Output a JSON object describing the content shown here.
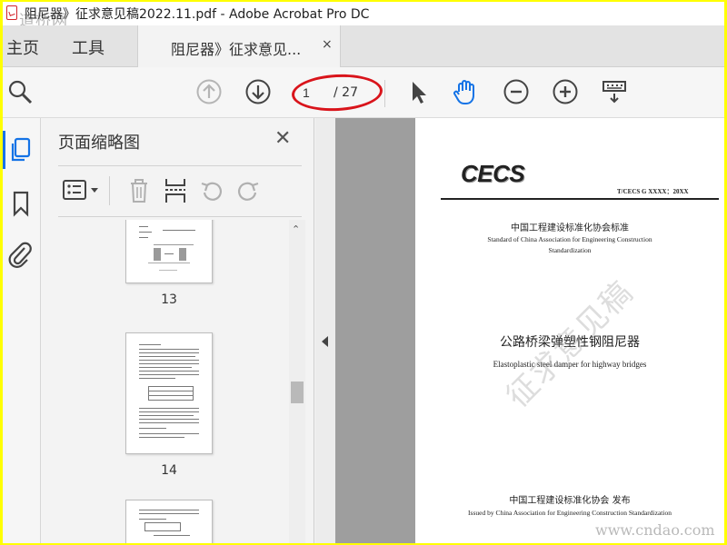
{
  "window": {
    "title": "阻尼器》征求意见稿2022.11.pdf - Adobe Acrobat Pro DC",
    "watermark_top": "道桥网"
  },
  "tabs": {
    "home": "主页",
    "tools": "工具",
    "document": "阻尼器》征求意见...",
    "close": "×"
  },
  "toolbar": {
    "current_page": "1",
    "total_pages": "/ 27",
    "icons": [
      "zoom-search-icon",
      "page-up-icon",
      "page-down-icon",
      "select-cursor-icon",
      "hand-icon",
      "zoom-out-icon",
      "zoom-in-icon",
      "keyboard-input-icon"
    ],
    "highlight_color": "#d9141b"
  },
  "sidebar": {
    "icons": [
      "page-thumbnails-icon",
      "bookmarks-icon",
      "attachments-icon"
    ],
    "accent": "#1a73e8"
  },
  "thumbnails_panel": {
    "title": "页面缩略图",
    "close": "✕",
    "tools": [
      "thumbnail-options-icon",
      "delete-pages-icon",
      "insert-page-icon",
      "rotate-ccw-icon",
      "rotate-cw-icon"
    ],
    "pages": [
      {
        "label": "13"
      },
      {
        "label": "14"
      }
    ]
  },
  "document_page": {
    "logo": "CECS",
    "standard_code": "T/CECS G XXXX：20XX",
    "org_cn": "中国工程建设标准化协会标准",
    "org_en_line1": "Standard of China Association for Engineering  Construction",
    "org_en_line2": "Standardization",
    "title_cn": "公路桥梁弹塑性钢阻尼器",
    "title_en": "Elastoplastic steel damper  for highway  bridges",
    "publisher_cn": "中国工程建设标准化协会    发布",
    "publisher_en": "Issued by China Association for Engineering  Construction Standardization",
    "draft_watermark": "征求意见稿",
    "site_watermark": "www.cndao.com"
  }
}
